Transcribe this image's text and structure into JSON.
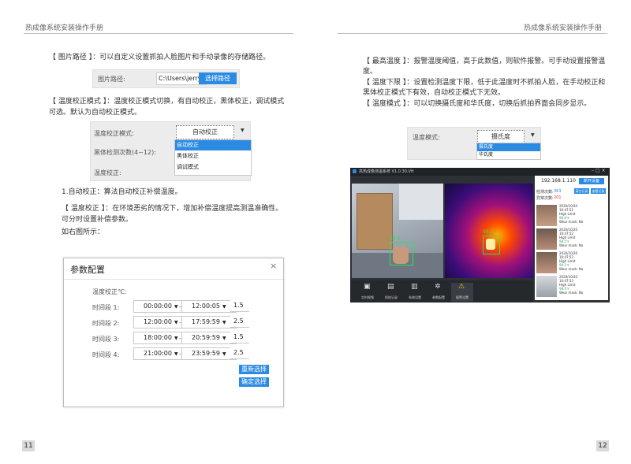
{
  "header": {
    "left_title": "热成像系统安装操作手册",
    "right_title": "热成像系统安装操作手册"
  },
  "left_page": {
    "para_path": "【 图片路径 】：可以自定义设置抓拍人脸图片和手动录像的存储路径。",
    "path_panel": {
      "label": "图片路径:",
      "value": "C:\\Users\\jerry\\D",
      "button": "选择路径"
    },
    "para_calib_1": "【 温度校正模式 】：温度校正模式切换，有自动校正，黑体校正，调试模式",
    "para_calib_2": "可选。默认为自动校正模式。",
    "calib_panel": {
      "mode_label": "温度校正模式:",
      "mode_value": "自动校正",
      "blackbody_label": "黑体检测次数(4~12):",
      "calib_label": "温度校正:",
      "options": [
        "自动校正",
        "黑体校正",
        "调试模式"
      ]
    },
    "para_auto": "1.自动校正：算法自动校正补偿温度。",
    "para_corr_1": "【 温度校正 】：在环境恶劣的情况下，增加补偿温度提高测温准确性。",
    "para_corr_2": "可分时设置补偿参数。",
    "para_fig": "如右图所示：",
    "dialog": {
      "title": "参数配置",
      "close": "×",
      "section_label": "温度校正℃:",
      "rows": [
        {
          "label": "时间段 1:",
          "start": "00:00:00",
          "end": "12:00:05",
          "value": "1.5"
        },
        {
          "label": "时间段 2:",
          "start": "12:00:00",
          "end": "17:59:59",
          "value": "2.5"
        },
        {
          "label": "时间段 3:",
          "start": "18:00:00",
          "end": "20:59:59",
          "value": "1.5"
        },
        {
          "label": "时间段 4:",
          "start": "21:00:00",
          "end": "23:59:59",
          "value": "2.5"
        }
      ],
      "dash": "-",
      "reselect_button": "重新选择",
      "confirm_button": "确定选择"
    },
    "page_number": "11"
  },
  "right_page": {
    "para_max_1": "【 最高温度 】：报警温度阈值，高于此数值，则软件报警。可手动设置报警温",
    "para_max_2": "度。",
    "para_min_1": "【 温度下限 】：设置检测温度下限，低于此温度时不抓拍人脸，在手动校正和",
    "para_min_2": "黑体校正模式下有效，自动校正模式下无效。",
    "para_mode": "【 温度模式 】：可以切换摄氏度和华氏度，切换后抓拍界面会同步显示。",
    "mode_panel": {
      "label": "温度模式:",
      "value": "摄氏度",
      "options": [
        "摄氏度",
        "华氏度"
      ]
    },
    "app": {
      "title": "高热成像测温系统 V1.0.30.VH",
      "ip": "192.168.1.110",
      "top_button": "断开设备",
      "count_label_1": "检测次数:",
      "count_value_1": "363",
      "count_label_2": "异常次数:",
      "count_value_2": "201",
      "btn_a": "清空记录",
      "btn_b": "查看记录",
      "temp_reading": "98.2",
      "face_reading": "36.5",
      "records": [
        {
          "date": "2020/10/20",
          "time": "10:47:51",
          "level": "High Limit",
          "temp": "98.6℉",
          "note": "Wear mask: No"
        },
        {
          "date": "2020/10/20",
          "time": "10:47:52",
          "level": "High Limit",
          "temp": "98.5℉",
          "note": "Wear mask: No"
        },
        {
          "date": "2020/10/20",
          "time": "10:47:52",
          "level": "High Limit",
          "temp": "99.1℉",
          "note": "Wear mask: No"
        },
        {
          "date": "2020/10/20",
          "time": "10:47:53",
          "level": "High Limit",
          "temp": "98.4℉",
          "note": "Wear mask: No"
        }
      ],
      "toolbar": [
        "实时视频",
        "抓拍记录",
        "系统设置",
        "参数配置",
        "报警设置"
      ]
    },
    "page_number": "12"
  },
  "colors": {
    "accent": "#2b8be3",
    "page_number_bg": "#d9d9d9"
  }
}
